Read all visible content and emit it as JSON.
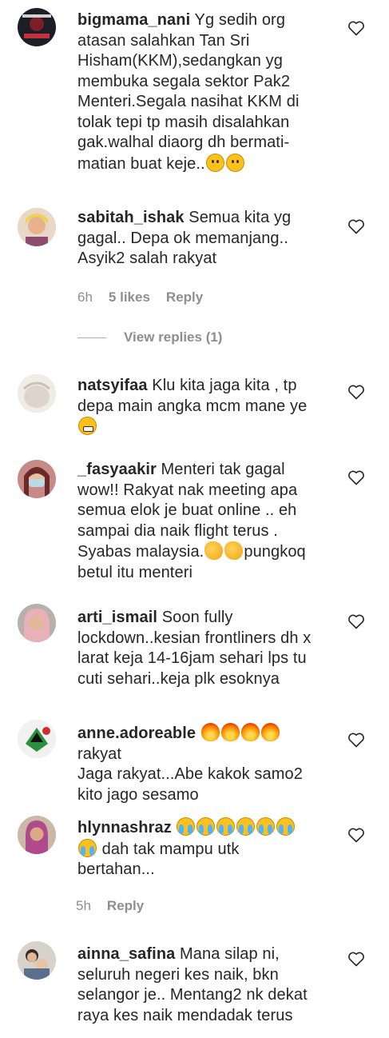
{
  "comments": [
    {
      "username": "bigmama_nani",
      "text": " Yg sedih org\natasan salahkan Tan Sri\nHisham(KKM),sedangkan yg\nmembuka segala sektor Pak2\nMenteri.Segala nasihat KKM di\ntolak tepi tp masih disalahkan\ngak.walhal diaorg dh bermati-\nmatian buat keje..",
      "emojis": [
        "worried",
        "worried"
      ]
    },
    {
      "username": "sabitah_ishak",
      "text": " Semua kita yg\ngagal.. Depa ok memanjang..\nAsyik2 salah rakyat",
      "emojis": [],
      "time": "6h",
      "likes": "5 likes",
      "reply": "Reply",
      "view_replies": "View replies (1)"
    },
    {
      "username": "natsyifaa",
      "text": " Klu kita jaga kita , tp\ndepa main angka mcm mane ye\n",
      "emojis": [
        "grimace"
      ]
    },
    {
      "username": "_fasyaakir",
      "text": " Menteri tak gagal\nwow!! Rakyat nak meeting apa\nsemua elok je buat online .. eh\nsampai dia naik flight terus .\nSyabas malaysia.",
      "emojis": [
        "clap",
        "clap"
      ],
      "text_after": "pungkoq\nbetul itu menteri"
    },
    {
      "username": "arti_ismail",
      "text": " Soon fully\nlockdown..kesian frontliners dh x\nlarat keja 14-16jam sehari lps tu\ncuti sehari..keja plk esoknya",
      "emojis": []
    },
    {
      "username": "anne.adoreable",
      "text": " ",
      "emojis": [
        "fire",
        "fire",
        "fire",
        "fire"
      ],
      "text_after": "rakyat\nJaga rakyat...Abe kakok samo2\nkito jago sesamo"
    },
    {
      "username": "hlynnashraz",
      "text": " ",
      "emojis": [
        "cry",
        "cry",
        "cry",
        "cry",
        "cry",
        "cry"
      ],
      "text_after": "\n",
      "emojis_line2": [
        "cry"
      ],
      "text_after2": " dah tak mampu utk\nbertahan...",
      "time": "5h",
      "reply": "Reply"
    },
    {
      "username": "ainna_safina",
      "text": " Mana silap ni,\nseluruh negeri kes naik, bkn\nselangor je.. Mentang2 nk dekat\nraya kes naik mendadak terus",
      "emojis": []
    }
  ],
  "icons": {
    "like": "heart-outline-icon"
  },
  "colors": {
    "text": "#262626",
    "meta": "#8e8e8e",
    "background": "#ffffff"
  }
}
